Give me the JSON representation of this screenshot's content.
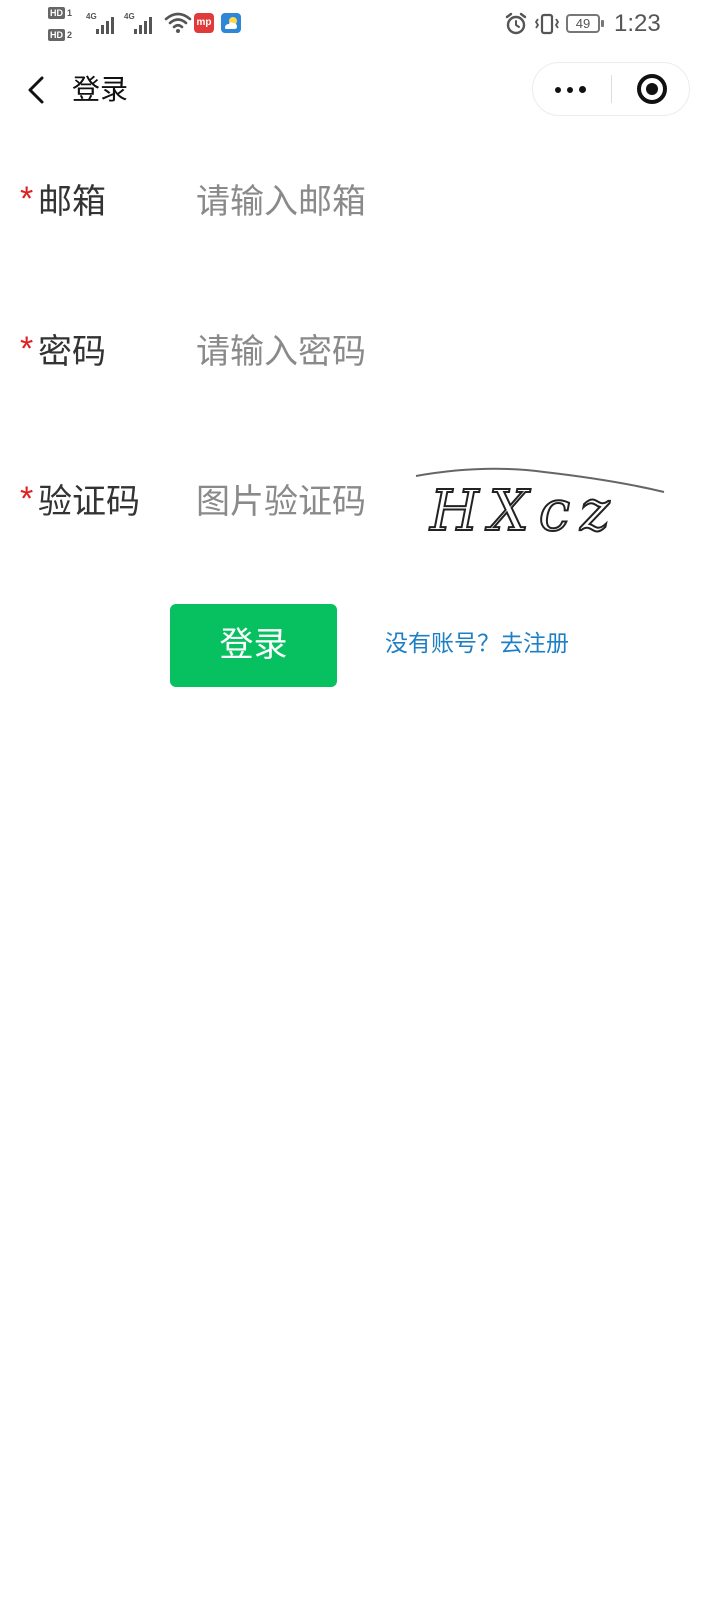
{
  "status_bar": {
    "hd1": "HD",
    "hd1_index": "1",
    "hd2": "HD",
    "hd2_index": "2",
    "signal1_label": "4G",
    "signal2_label": "4G",
    "app1_badge": "mp",
    "battery": "49",
    "time": "1:23",
    "icons": [
      "wifi-icon",
      "alarm-icon",
      "vibrate-icon",
      "battery-icon"
    ]
  },
  "navbar": {
    "title": "登录",
    "back_icon": "chevron-left-icon",
    "capsule_icons": [
      "more-dots-icon",
      "target-circle-icon"
    ]
  },
  "form": {
    "required_mark": "*",
    "email": {
      "label": "邮箱",
      "placeholder": "请输入邮箱",
      "value": ""
    },
    "password": {
      "label": "密码",
      "placeholder": "请输入密码",
      "value": ""
    },
    "captcha": {
      "label": "验证码",
      "placeholder": "图片验证码",
      "value": "",
      "image_text": "HXcz"
    }
  },
  "actions": {
    "login_label": "登录",
    "register_link": "没有账号？去注册"
  },
  "colors": {
    "primary_button": "#07c160",
    "link": "#1f7fc4",
    "required": "#e02020",
    "placeholder": "#8a8a8a"
  }
}
